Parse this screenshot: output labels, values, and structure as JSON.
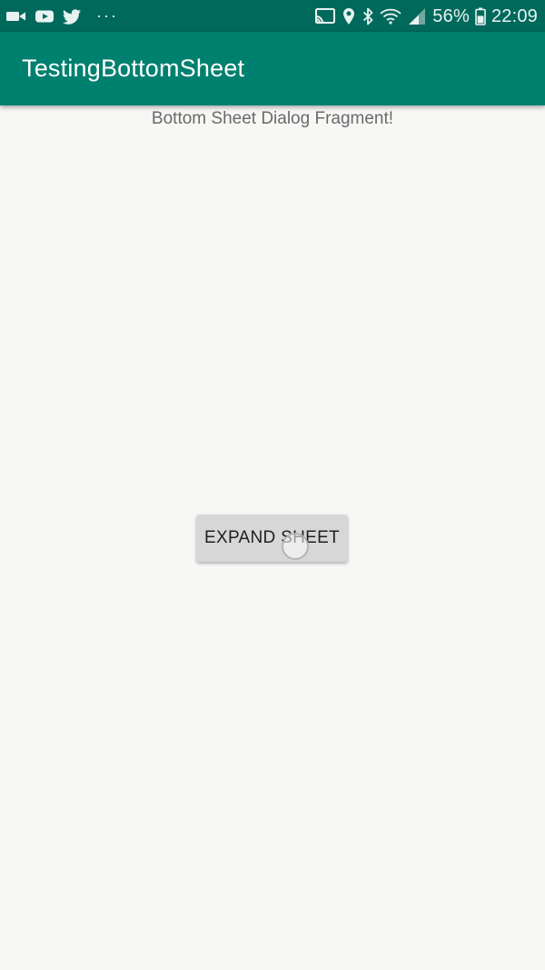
{
  "status_bar": {
    "icons_left": [
      "video-camera-icon",
      "youtube-icon",
      "twitter-icon"
    ],
    "more_indicator": "···",
    "icons_right": [
      "cast-icon",
      "location-icon",
      "bluetooth-icon",
      "wifi-icon",
      "signal-icon",
      "battery-icon"
    ],
    "battery_percent": "56%",
    "time": "22:09"
  },
  "app_bar": {
    "title": "TestingBottomSheet"
  },
  "main": {
    "header": "Bottom Sheet Dialog Fragment!",
    "button_label": "EXPAND SHEET"
  },
  "colors": {
    "status_bar": "#00695c",
    "app_bar": "#00806f",
    "background": "#f7f7f5",
    "button": "#d7d7d7"
  }
}
